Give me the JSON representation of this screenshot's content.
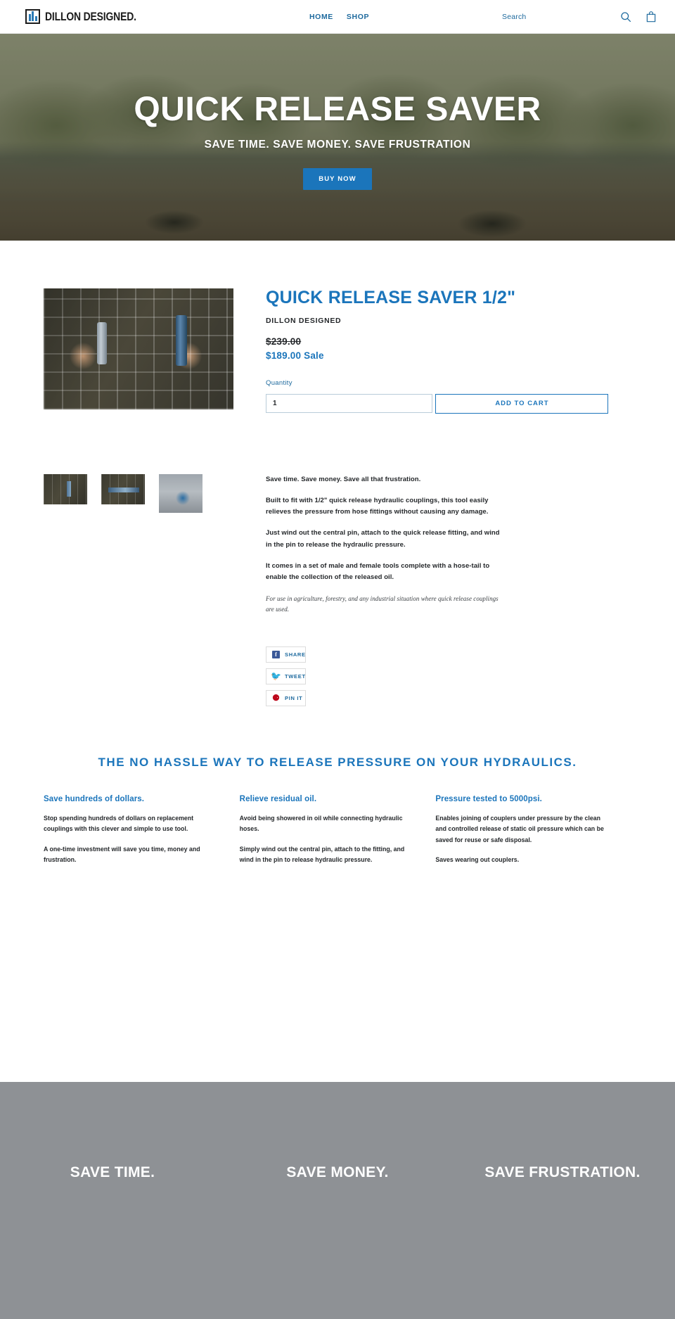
{
  "header": {
    "logo_text": "DILLON DESIGNED.",
    "nav": [
      {
        "label": "HOME"
      },
      {
        "label": "SHOP"
      }
    ],
    "search_label": "Search",
    "search_icon": "search-icon",
    "cart_icon": "shopping-bag-icon"
  },
  "hero": {
    "title": "QUICK RELEASE SAVER",
    "subtitle": "SAVE TIME. SAVE MONEY. SAVE FRUSTRATION",
    "cta_label": "BUY NOW",
    "cta_color": "#1b75bb"
  },
  "product": {
    "title": "QUICK RELEASE SAVER 1/2\"",
    "vendor": "DILLON DESIGNED",
    "price_compare": "$239.00",
    "price_sale": "$189.00 Sale",
    "quantity_label": "Quantity",
    "quantity_value": "1",
    "add_to_cart_label": "ADD TO CART",
    "accent_color": "#1b75bb",
    "description": [
      "Save time. Save money. Save all that frustration.",
      "Built to fit with 1/2\" quick release hydraulic couplings, this tool easily relieves the pressure from hose fittings without causing any damage.",
      "Just wind out the central pin, attach to the quick release fitting, and wind in the pin to release the hydraulic pressure.",
      "It comes in a set of male and female tools complete with a hose-tail to enable the collection of the released oil."
    ],
    "description_note": "For use in agriculture, forestry, and any industrial situation where quick release couplings are used.",
    "share": [
      {
        "label": "SHARE",
        "icon": "facebook-icon",
        "color": "#3b5998"
      },
      {
        "label": "TWEET",
        "icon": "twitter-icon",
        "color": "#55acee"
      },
      {
        "label": "PIN IT",
        "icon": "pinterest-icon",
        "color": "#bd081c"
      }
    ]
  },
  "features": {
    "heading": "THE NO HASSLE WAY TO RELEASE PRESSURE ON YOUR HYDRAULICS.",
    "columns": [
      {
        "title": "Save hundreds of dollars.",
        "p1": "Stop spending hundreds of dollars on replacement couplings with this clever and simple to use tool.",
        "p2": "A one-time investment will save you time, money and frustration."
      },
      {
        "title": "Relieve residual oil.",
        "p1": "Avoid being showered in oil while connecting hydraulic hoses.",
        "p2": "Simply wind out the central pin, attach to the fitting, and wind in the pin to release hydraulic pressure."
      },
      {
        "title": "Pressure tested to 5000psi.",
        "p1": "Enables joining of couplers under pressure by the clean and controlled release of static oil pressure which can be saved for reuse or safe disposal.",
        "p2": "Saves wearing out couplers."
      }
    ]
  },
  "banner": {
    "background": "#8e9195",
    "items": [
      {
        "label": "SAVE TIME."
      },
      {
        "label": "SAVE MONEY."
      },
      {
        "label": "SAVE FRUSTRATION."
      }
    ]
  }
}
